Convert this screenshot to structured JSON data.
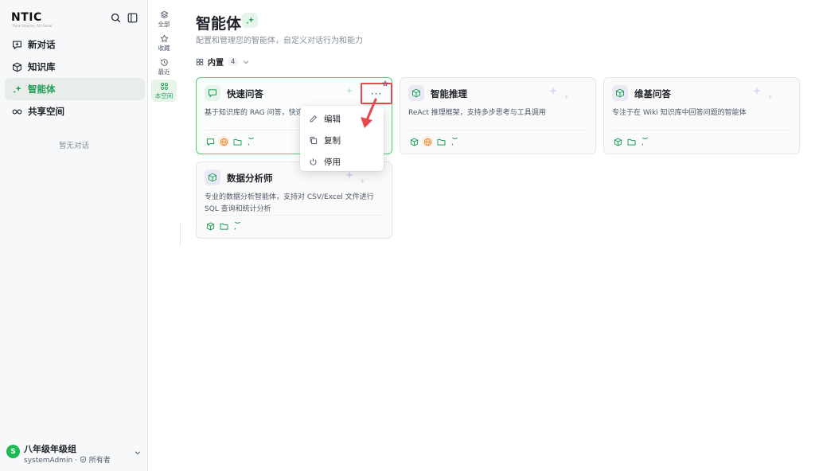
{
  "sidebar": {
    "logo": "NTIC",
    "logo_sub": "Think Smarter, Act Faster",
    "nav": [
      {
        "label": "新对话",
        "icon": "chat-plus-icon"
      },
      {
        "label": "知识库",
        "icon": "cube-icon"
      },
      {
        "label": "智能体",
        "icon": "sparkle-icon",
        "active": true
      },
      {
        "label": "共享空间",
        "icon": "infinity-icon"
      }
    ],
    "empty_hint": "暂无对话",
    "user": {
      "avatar": "S",
      "name": "八年级年级组",
      "account": "systemAdmin",
      "role": "所有者"
    }
  },
  "rail": [
    {
      "label": "全部",
      "icon": "layers-icon"
    },
    {
      "label": "收藏",
      "icon": "star-icon"
    },
    {
      "label": "最近",
      "icon": "history-icon"
    },
    {
      "label": "本空间",
      "icon": "cluster-icon",
      "active": true
    }
  ],
  "main": {
    "title": "智能体",
    "description": "配置和管理您的智能体，自定义对话行为和能力",
    "filter": {
      "label": "内置",
      "count": "4"
    },
    "cards": [
      {
        "title": "快速问答",
        "desc": "基于知识库的 RAG 问答，快速准",
        "icon": "chat-icon",
        "tools": [
          "chat",
          "globe",
          "folder",
          "message"
        ]
      },
      {
        "title": "智能推理",
        "desc": "ReAct 推理框架，支持多步思考与工具调用",
        "icon": "cube-icon",
        "tools": [
          "cube",
          "globe",
          "folder",
          "message"
        ]
      },
      {
        "title": "维基问答",
        "desc": "专注于在 Wiki 知识库中回答问题的智能体",
        "icon": "cube-icon",
        "tools": [
          "cube",
          "folder",
          "message"
        ]
      },
      {
        "title": "数据分析师",
        "desc": "专业的数据分析智能体，支持对 CSV/Excel 文件进行 SQL 查询和统计分析",
        "icon": "cube-icon",
        "tools": [
          "cube",
          "folder",
          "message"
        ]
      }
    ],
    "context_menu": [
      "编辑",
      "复制",
      "停用"
    ]
  },
  "colors": {
    "accent": "#1f9d55",
    "highlight": "#e5484d",
    "sidebar_bg": "#f7f8fa"
  }
}
